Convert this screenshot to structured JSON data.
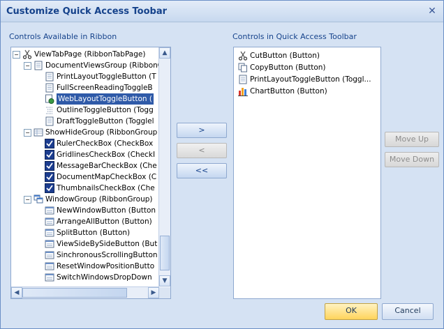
{
  "window": {
    "title": "Customize Quick Access Toobar",
    "close_glyph": "✕"
  },
  "left": {
    "label": "Controls Available in Ribbon",
    "tree": [
      {
        "label": "ViewTabPage (RibbonTabPage)",
        "icon": "scissors-icon",
        "level": 0,
        "expander": "−"
      },
      {
        "label": "DocumentViewsGroup (RibbonG",
        "icon": "page-icon",
        "level": 1,
        "expander": "−"
      },
      {
        "label": "PrintLayoutToggleButton (T",
        "icon": "page-icon",
        "level": 2
      },
      {
        "label": "FullScreenReadingToggleB",
        "icon": "page-icon",
        "level": 2
      },
      {
        "label": "WebLayoutToggleButton (",
        "icon": "globe-page-icon",
        "level": 2,
        "selected": true
      },
      {
        "label": "OutlineToggleButton (Togg",
        "icon": "outline-icon",
        "level": 2
      },
      {
        "label": "DraftToggleButton (Togglel",
        "icon": "page-icon",
        "level": 2
      },
      {
        "label": "ShowHideGroup (RibbonGroup",
        "icon": "grid-icon",
        "level": 1,
        "expander": "−"
      },
      {
        "label": "RulerCheckBox (CheckBox",
        "icon": "checkbox-icon",
        "level": 2
      },
      {
        "label": "GridlinesCheckBox (CheckI",
        "icon": "checkbox-icon",
        "level": 2
      },
      {
        "label": "MessageBarCheckBox (Che",
        "icon": "checkbox-icon",
        "level": 2
      },
      {
        "label": "DocumentMapCheckBox (C",
        "icon": "checkbox-icon",
        "level": 2
      },
      {
        "label": "ThumbnailsCheckBox (Che",
        "icon": "checkbox-icon",
        "level": 2
      },
      {
        "label": "WindowGroup (RibbonGroup)",
        "icon": "windows-icon",
        "level": 1,
        "expander": "−"
      },
      {
        "label": "NewWindowButton (Button",
        "icon": "new-window-icon",
        "level": 2
      },
      {
        "label": "ArrangeAllButton (Button)",
        "icon": "arrange-icon",
        "level": 2
      },
      {
        "label": "SplitButton (Button)",
        "icon": "split-icon",
        "level": 2
      },
      {
        "label": "ViewSideBySideButton (But",
        "icon": "side-by-side-icon",
        "level": 2
      },
      {
        "label": "SinchronousScrollingButton",
        "icon": "sync-scroll-icon",
        "level": 2
      },
      {
        "label": "ResetWindowPositionButto",
        "icon": "reset-window-icon",
        "level": 2
      },
      {
        "label": "SwitchWindowsDropDown",
        "icon": "switch-windows-icon",
        "level": 2
      }
    ]
  },
  "buttons": {
    "add": ">",
    "remove": "<",
    "remove_all": "<<",
    "move_up": "Move Up",
    "move_down": "Move Down",
    "ok": "OK",
    "cancel": "Cancel"
  },
  "right": {
    "label": "Controls in Quick Access Toolbar",
    "items": [
      {
        "label": "CutButton (Button)",
        "icon": "scissors-icon"
      },
      {
        "label": "CopyButton (Button)",
        "icon": "copy-icon"
      },
      {
        "label": "PrintLayoutToggleButton (Toggl...",
        "icon": "page-icon"
      },
      {
        "label": "ChartButton (Button)",
        "icon": "chart-icon"
      }
    ]
  },
  "colors": {
    "dialog_bg": "#d5e2f3",
    "selection": "#2f5aa8",
    "ok_button": "#ffd45c",
    "title_text": "#15428b"
  }
}
